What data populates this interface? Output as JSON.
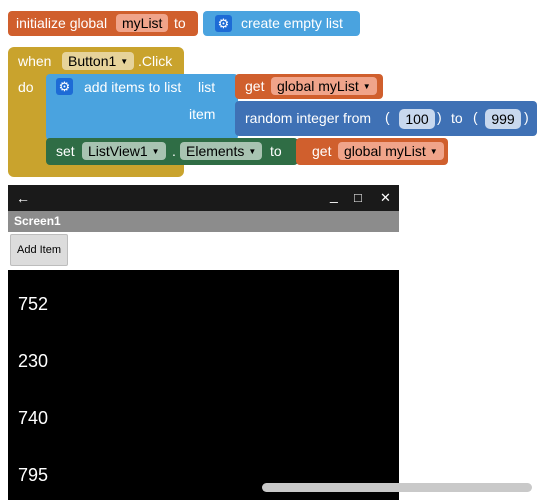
{
  "blocks": {
    "init": {
      "prefix": "initialize global",
      "var_name": "myList",
      "to": "to",
      "value": "create empty list"
    },
    "event": {
      "when": "when",
      "component": "Button1",
      "event": ".Click",
      "do": "do"
    },
    "add_items": {
      "label": "add items to list",
      "list_socket": "list",
      "item_socket": "item",
      "list_get": "get",
      "list_var": "global myList",
      "random_label": "random integer from",
      "from": "100",
      "to_label": "to",
      "to": "999"
    },
    "set": {
      "set": "set",
      "component": "ListView1",
      "dot": ".",
      "property": "Elements",
      "to": "to",
      "get": "get",
      "var": "global myList"
    }
  },
  "phone": {
    "back": "←",
    "minimize": "_",
    "maximize": "□",
    "close": "✕",
    "screen_title": "Screen1",
    "button_label": "Add Item",
    "list_items": [
      "752",
      "230",
      "740",
      "795"
    ]
  },
  "colors": {
    "variables": "#d05f2d",
    "lists": "#4aa3df",
    "control": "#c9a32d",
    "math": "#3f71b5",
    "components": "#2f6d45"
  },
  "icons": {
    "gear": "gear-icon",
    "dropdown": "dropdown-arrow-icon"
  }
}
